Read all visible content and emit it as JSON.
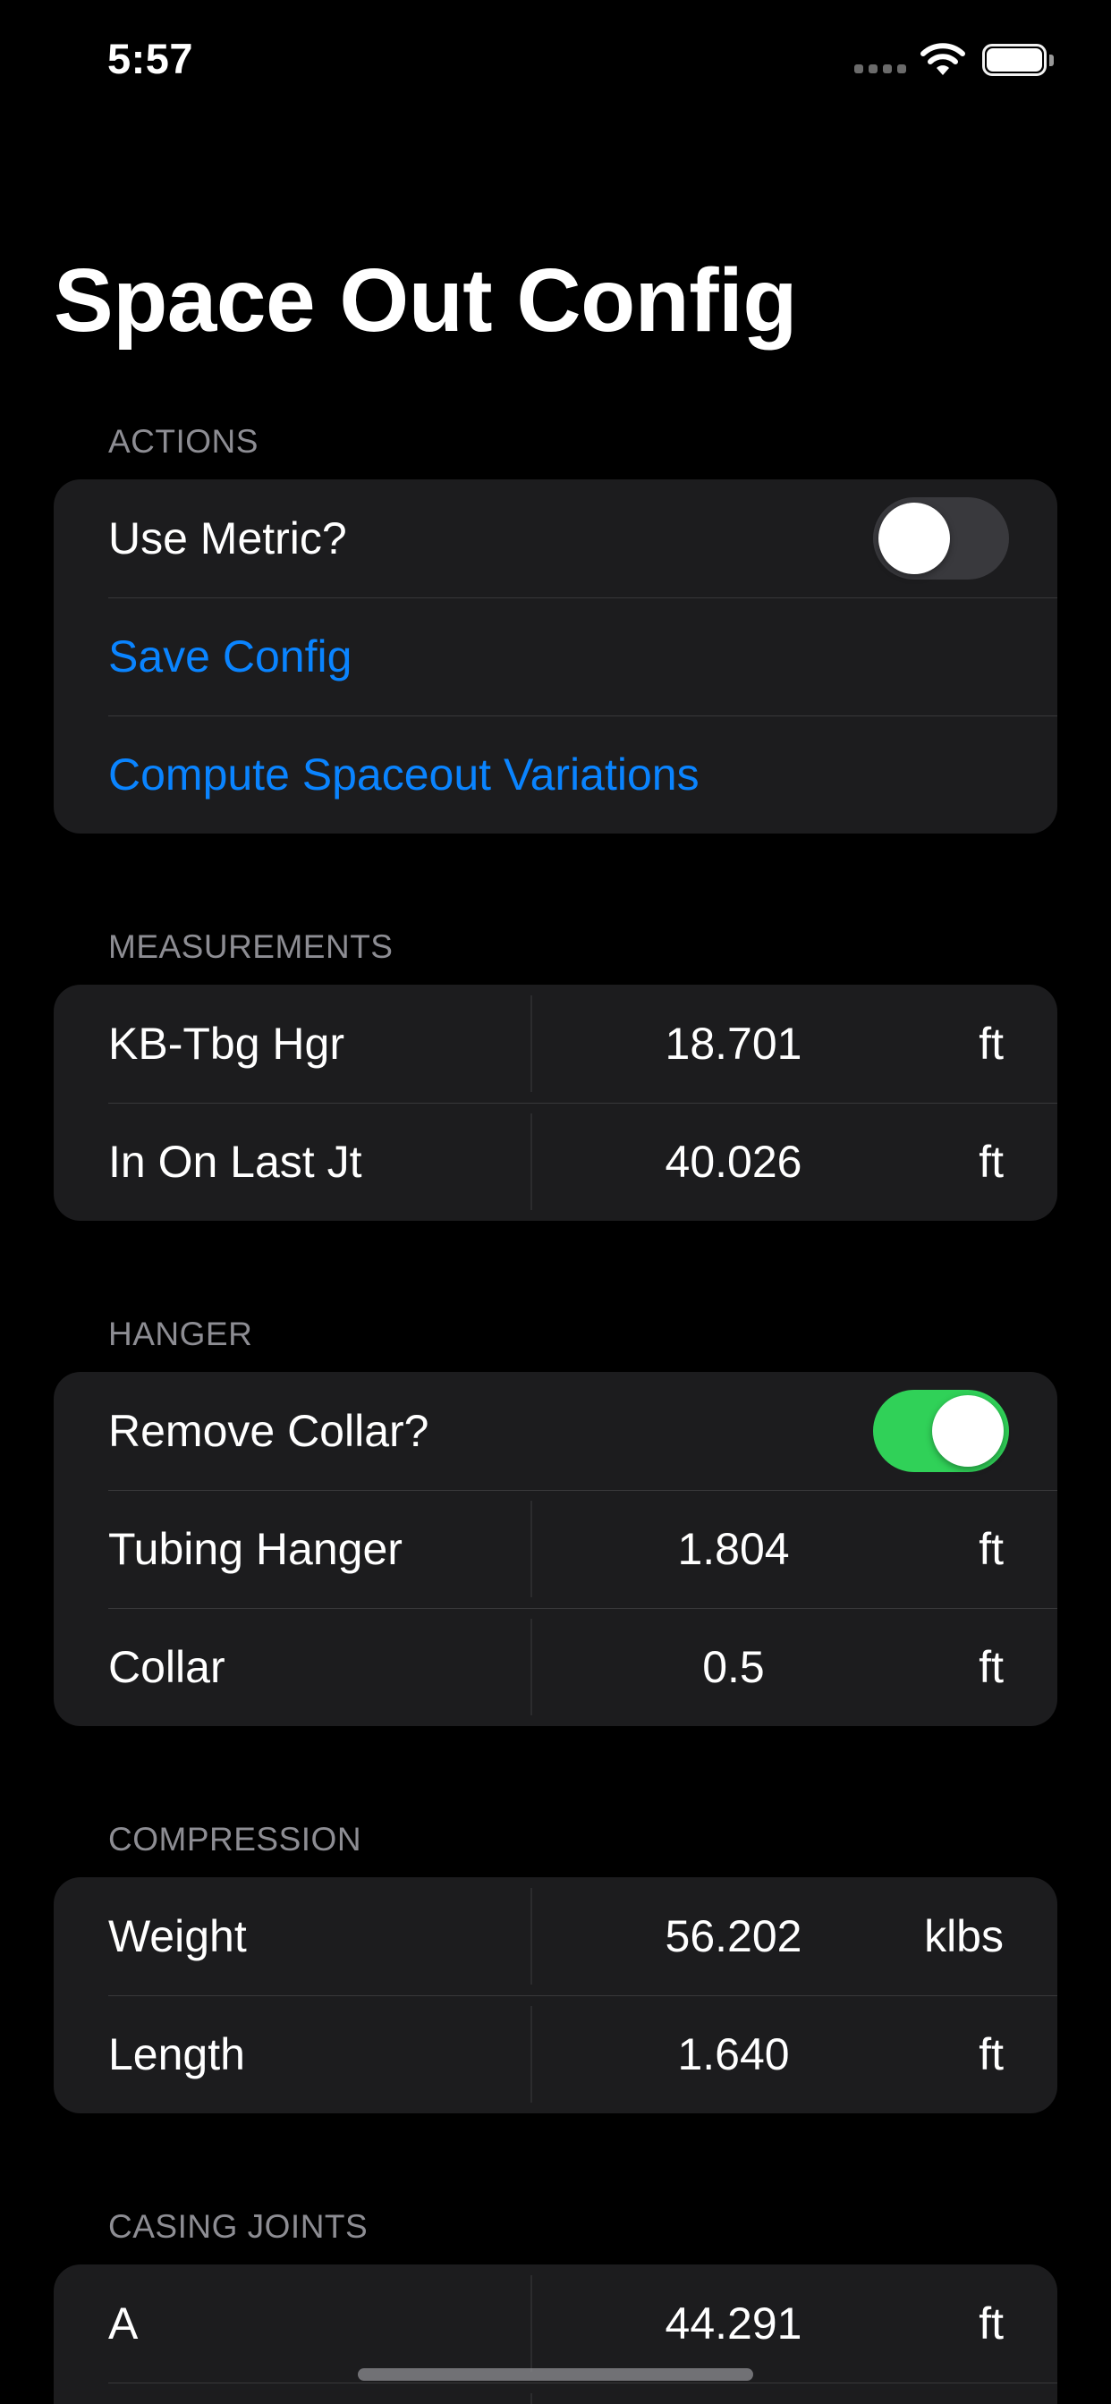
{
  "status_bar": {
    "time": "5:57",
    "signal_icon": "cellular-signal-icon",
    "wifi_icon": "wifi-icon",
    "battery_icon": "battery-icon",
    "battery_level": 1.0
  },
  "title": "Space Out Config",
  "colors": {
    "background": "#000000",
    "group_background": "#1c1c1e",
    "link": "#0a84ff",
    "toggle_on": "#30d158",
    "toggle_off": "#39393d",
    "section_header": "#8d8d93"
  },
  "sections": {
    "actions": {
      "header": "ACTIONS",
      "use_metric": {
        "label": "Use Metric?",
        "on": false
      },
      "save_config": "Save Config",
      "compute": "Compute Spaceout Variations"
    },
    "measurements": {
      "header": "MEASUREMENTS",
      "rows": [
        {
          "label": "KB-Tbg Hgr",
          "value": "18.701",
          "unit": "ft"
        },
        {
          "label": "In On Last Jt",
          "value": "40.026",
          "unit": "ft"
        }
      ]
    },
    "hanger": {
      "header": "HANGER",
      "remove_collar": {
        "label": "Remove Collar?",
        "on": true
      },
      "rows": [
        {
          "label": "Tubing Hanger",
          "value": "1.804",
          "unit": "ft"
        },
        {
          "label": "Collar",
          "value": "0.5",
          "unit": "ft"
        }
      ]
    },
    "compression": {
      "header": "COMPRESSION",
      "rows": [
        {
          "label": "Weight",
          "value": "56.202",
          "unit": "klbs"
        },
        {
          "label": "Length",
          "value": "1.640",
          "unit": "ft"
        }
      ]
    },
    "casing_joints": {
      "header": "CASING JOINTS",
      "rows": [
        {
          "label": "A",
          "value": "44.291",
          "unit": "ft"
        }
      ]
    }
  }
}
